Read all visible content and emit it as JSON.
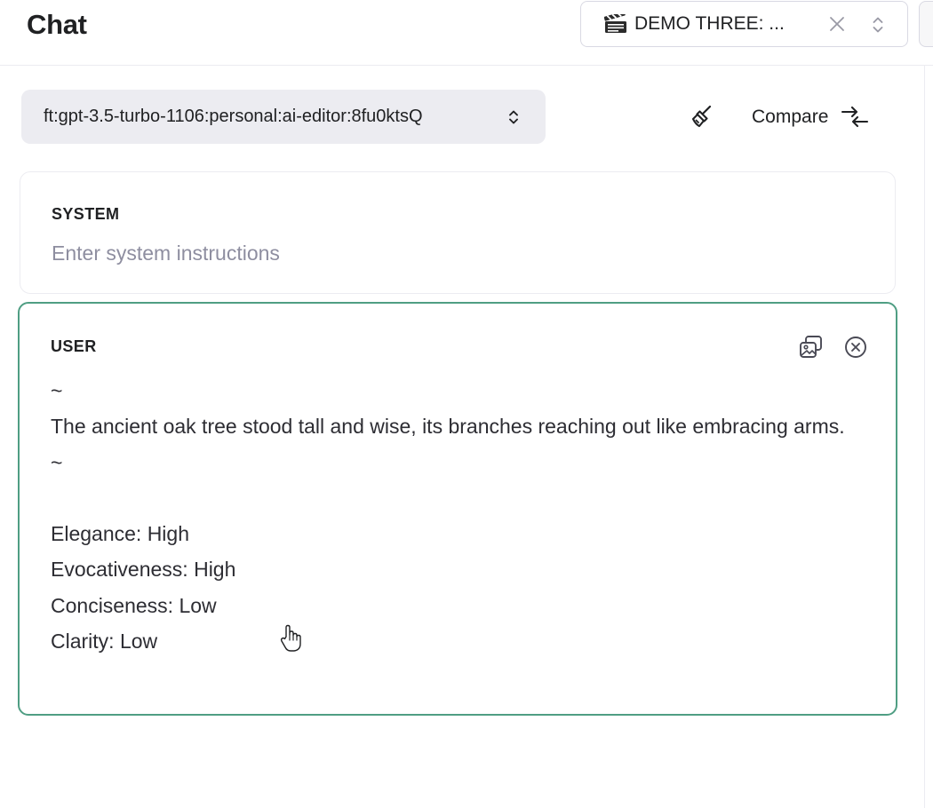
{
  "header": {
    "title": "Chat",
    "preset": {
      "label": "DEMO THREE: ...",
      "icon": "clapperboard-icon",
      "clear_icon": "close-icon",
      "toggle_icon": "chevron-up-down-icon"
    }
  },
  "model_selector": {
    "value": "ft:gpt-3.5-turbo-1106:personal:ai-editor:8fu0ktsQ",
    "icon": "chevron-up-down-icon"
  },
  "toolbar": {
    "clear_icon": "broom-icon",
    "compare_label": "Compare",
    "compare_icon": "arrows-compare-icon"
  },
  "messages": [
    {
      "role": "SYSTEM",
      "value": "",
      "placeholder": "Enter system instructions"
    },
    {
      "role": "USER",
      "actions": [
        "add-image-icon",
        "remove-circle-icon"
      ],
      "lines": [
        "~",
        "The ancient oak tree stood tall and wise, its branches reaching out like embracing arms.",
        "~",
        "",
        "Elegance: High",
        "Evocativeness: High",
        "Conciseness: Low",
        "Clarity: Low"
      ]
    }
  ],
  "colors": {
    "accent_border": "#4f9e83",
    "model_select_bg": "#ececf1",
    "text": "#2d2d33",
    "placeholder": "#8e8ea0"
  }
}
